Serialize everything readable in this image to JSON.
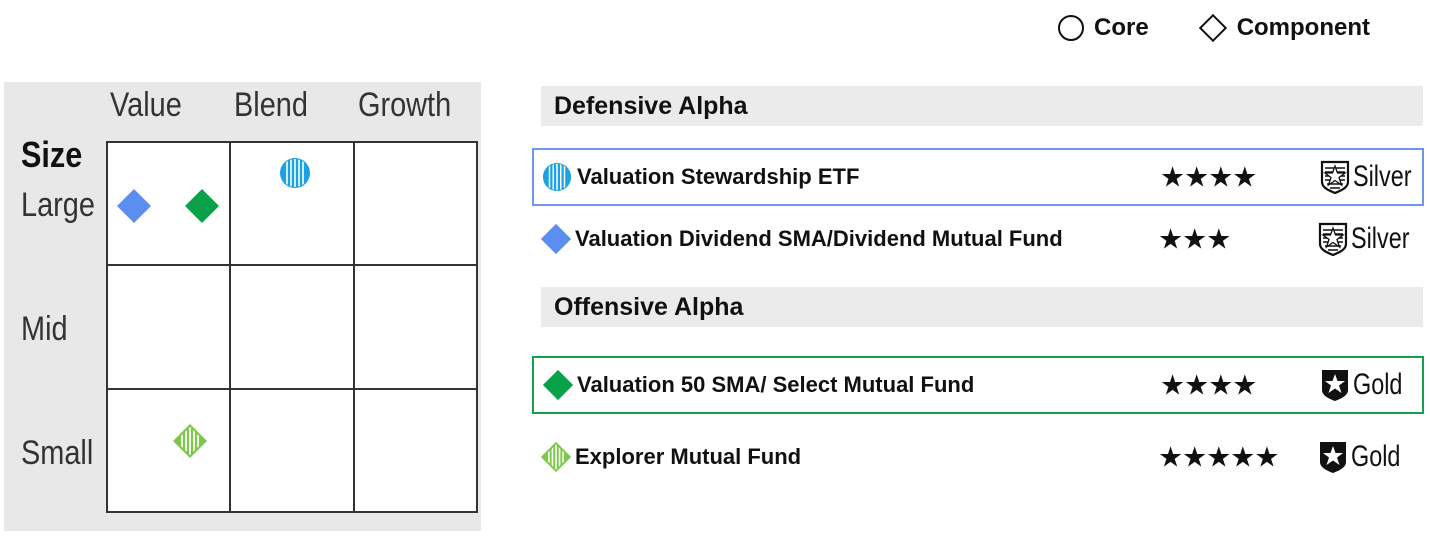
{
  "legend": {
    "core_label": "Core",
    "component_label": "Component"
  },
  "style_box": {
    "columns": [
      "Value",
      "Blend",
      "Growth"
    ],
    "size_label": "Size",
    "rows": [
      "Large",
      "Mid",
      "Small"
    ],
    "markers": [
      {
        "fund": "Valuation Stewardship ETF",
        "shape": "circle",
        "style": "striped",
        "color": "#1aa3e0",
        "row": "Large",
        "column": "Blend"
      },
      {
        "fund": "Valuation Dividend SMA/Dividend Mutual Fund",
        "shape": "diamond",
        "style": "solid",
        "color": "#5b8ef0",
        "row": "Large",
        "column": "Value"
      },
      {
        "fund": "Valuation 50 SMA/ Select Mutual Fund",
        "shape": "diamond",
        "style": "solid",
        "color": "#0aa14b",
        "row": "Large",
        "column": "Value"
      },
      {
        "fund": "Explorer Mutual Fund",
        "shape": "diamond",
        "style": "striped",
        "color": "#7dc84a",
        "row": "Small",
        "column": "Value"
      }
    ]
  },
  "sections": [
    {
      "title": "Defensive Alpha",
      "funds": [
        {
          "name": "Valuation Stewardship ETF",
          "stars": "★★★★",
          "star_count": 4,
          "medal": "Silver",
          "icon": "striped-circle-icon",
          "icon_color": "#1aa3e0",
          "highlight": "#6f95e8"
        },
        {
          "name": "Valuation Dividend SMA/Dividend Mutual Fund",
          "stars": "★★★",
          "star_count": 3,
          "medal": "Silver",
          "icon": "solid-diamond-icon",
          "icon_color": "#5b8ef0",
          "highlight": ""
        }
      ]
    },
    {
      "title": "Offensive Alpha",
      "funds": [
        {
          "name": "Valuation 50 SMA/ Select Mutual Fund",
          "stars": "★★★★",
          "star_count": 4,
          "medal": "Gold",
          "icon": "solid-diamond-icon",
          "icon_color": "#0aa14b",
          "highlight": "#14a04d"
        },
        {
          "name": "Explorer Mutual Fund",
          "stars": "★★★★★",
          "star_count": 5,
          "medal": "Gold",
          "icon": "striped-diamond-icon",
          "icon_color": "#7dc84a",
          "highlight": ""
        }
      ]
    }
  ]
}
